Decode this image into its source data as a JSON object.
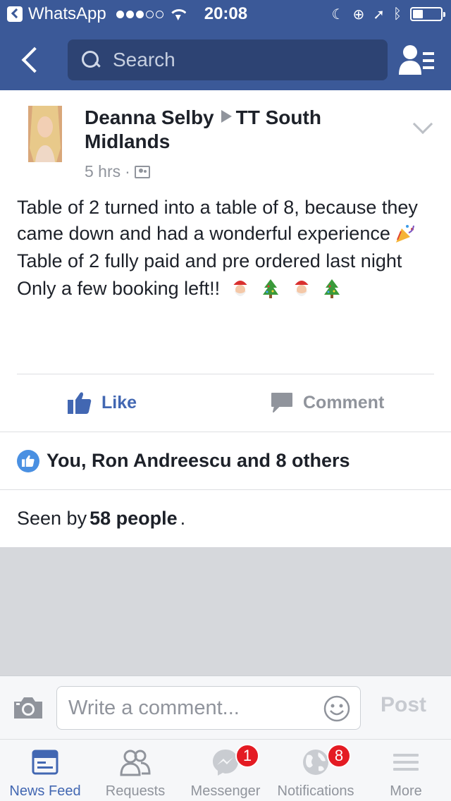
{
  "status_bar": {
    "back_app": "WhatsApp",
    "time": "20:08"
  },
  "nav": {
    "search_placeholder": "Search"
  },
  "post": {
    "author": "Deanna Selby",
    "group": "TT South Midlands",
    "time": "5 hrs",
    "time_separator": "·",
    "lines": [
      "Table of 2 turned into a table of 8, because they came down and had a wonderful experience",
      "Table of 2 fully paid and pre ordered last night",
      "Only a few booking left!!"
    ],
    "like_label": "Like",
    "comment_label": "Comment"
  },
  "reactions": {
    "text": "You, Ron Andreescu and 8 others"
  },
  "seen": {
    "prefix": "Seen by",
    "count": "58 people",
    "suffix": "."
  },
  "comment_bar": {
    "placeholder": "Write a comment...",
    "post_label": "Post"
  },
  "tabs": [
    {
      "label": "News Feed",
      "icon": "news-feed-icon",
      "active": true
    },
    {
      "label": "Requests",
      "icon": "requests-icon"
    },
    {
      "label": "Messenger",
      "icon": "messenger-icon",
      "badge": "1"
    },
    {
      "label": "Notifications",
      "icon": "globe-icon",
      "badge": "8"
    },
    {
      "label": "More",
      "icon": "menu-icon"
    }
  ],
  "colors": {
    "brand": "#3b5998",
    "link": "#4267b2",
    "badge": "#e41b23"
  }
}
